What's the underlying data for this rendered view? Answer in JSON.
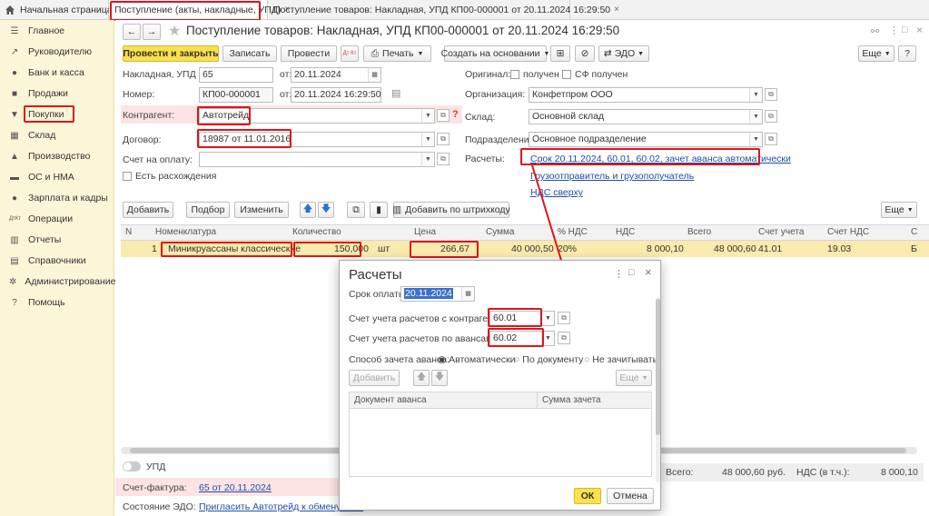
{
  "tabs": [
    {
      "label": "Начальная страница"
    },
    {
      "label": "Поступление (акты, накладные, УПД)"
    },
    {
      "label": "Поступление товаров: Накладная, УПД КП00-000001 от 20.11.2024 16:29:50"
    }
  ],
  "sidebar": {
    "items": [
      {
        "label": "Главное",
        "icon": "menu-icon"
      },
      {
        "label": "Руководителю",
        "icon": "chart-line-icon"
      },
      {
        "label": "Банк и касса",
        "icon": "coins-icon"
      },
      {
        "label": "Продажи",
        "icon": "bag-icon"
      },
      {
        "label": "Покупки",
        "icon": "cart-icon"
      },
      {
        "label": "Склад",
        "icon": "warehouse-icon"
      },
      {
        "label": "Производство",
        "icon": "factory-icon"
      },
      {
        "label": "ОС и НМА",
        "icon": "truck-icon"
      },
      {
        "label": "Зарплата и кадры",
        "icon": "person-icon"
      },
      {
        "label": "Операции",
        "icon": "dt-kt-icon"
      },
      {
        "label": "Отчеты",
        "icon": "bar-chart-icon"
      },
      {
        "label": "Справочники",
        "icon": "book-icon"
      },
      {
        "label": "Администрирование",
        "icon": "gear-icon"
      },
      {
        "label": "Помощь",
        "icon": "question-icon"
      }
    ]
  },
  "doc": {
    "title": "Поступление товаров: Накладная, УПД КП00-000001 от 20.11.2024 16:29:50"
  },
  "toolbar": {
    "post_close": "Провести и закрыть",
    "save": "Записать",
    "post": "Провести",
    "dtkt": "Дт Кт",
    "print": "Печать",
    "create_based": "Создать на основании",
    "edo": "ЭДО",
    "more": "Еще",
    "help": "?"
  },
  "form": {
    "invoice_label": "Накладная, УПД №:",
    "invoice_value": "65",
    "from": "от:",
    "invoice_date": "20.11.2024",
    "number_label": "Номер:",
    "number_value": "КП00-000001",
    "number_date": "20.11.2024 16:29:50",
    "counterparty_label": "Контрагент:",
    "counterparty_value": "Автотрейд",
    "contract_label": "Договор:",
    "contract_value": "18987 от 11.01.2016",
    "payment_label": "Счет на оплату:",
    "discrepancy_label": "Есть расхождения",
    "original_label": "Оригинал:",
    "received_label": "получен",
    "sf_received_label": "СФ получен",
    "organization_label": "Организация:",
    "organization_value": "Конфетпром ООО",
    "warehouse_label": "Склад:",
    "warehouse_value": "Основной склад",
    "division_label": "Подразделение:",
    "division_value": "Основное подразделение",
    "settlements_label": "Расчеты:",
    "settlements_link": "Срок 20.11.2024, 60.01, 60.02, зачет аванса автоматически",
    "shipper_link": "Грузоотправитель и грузополучатель",
    "vat_link": "НДС сверху"
  },
  "tabletoolbar": {
    "add": "Добавить",
    "pick": "Подбор",
    "change": "Изменить",
    "barcode": "Добавить по штрихкоду",
    "more": "Еще"
  },
  "table": {
    "headers": [
      "N",
      "Номенклатура",
      "Количество",
      "Цена",
      "Сумма",
      "% НДС",
      "НДС",
      "Всего",
      "Счет учета",
      "Счет НДС",
      "С"
    ],
    "row": {
      "n": "1",
      "item": "Миникруассаны классические",
      "qty": "150,000",
      "unit": "шт",
      "price": "266,67",
      "sum": "40 000,50",
      "vat_rate": "20%",
      "vat": "8 000,10",
      "total": "48 000,60",
      "account": "41.01",
      "vat_account": "19.03",
      "extra": "Б"
    }
  },
  "footer": {
    "upd_label": "УПД",
    "invoice_label": "Счет-фактура:",
    "invoice_link": "65 от 20.11.2024",
    "edo_label": "Состояние ЭДО:",
    "edo_link": "Пригласить Автотрейд к обмену элек",
    "total_label": "Всего:",
    "total_value": "48 000,60",
    "currency": "руб.",
    "vat_label": "НДС (в т.ч.):",
    "vat_value": "8 000,10"
  },
  "dialog": {
    "title": "Расчеты",
    "due_label": "Срок оплаты:",
    "due_value": "20.11.2024",
    "acc_cp_label": "Счет учета расчетов с контрагентом:",
    "acc_cp_value": "60.01",
    "acc_adv_label": "Счет учета расчетов по авансам:",
    "acc_adv_value": "60.02",
    "offset_label": "Способ зачета аванса:",
    "opt_auto": "Автоматически",
    "opt_doc": "По документу",
    "opt_none": "Не зачитывать",
    "add": "Добавить",
    "more": "Еще",
    "col_doc": "Документ аванса",
    "col_sum": "Сумма зачета",
    "ok": "ОК",
    "cancel": "Отмена"
  }
}
